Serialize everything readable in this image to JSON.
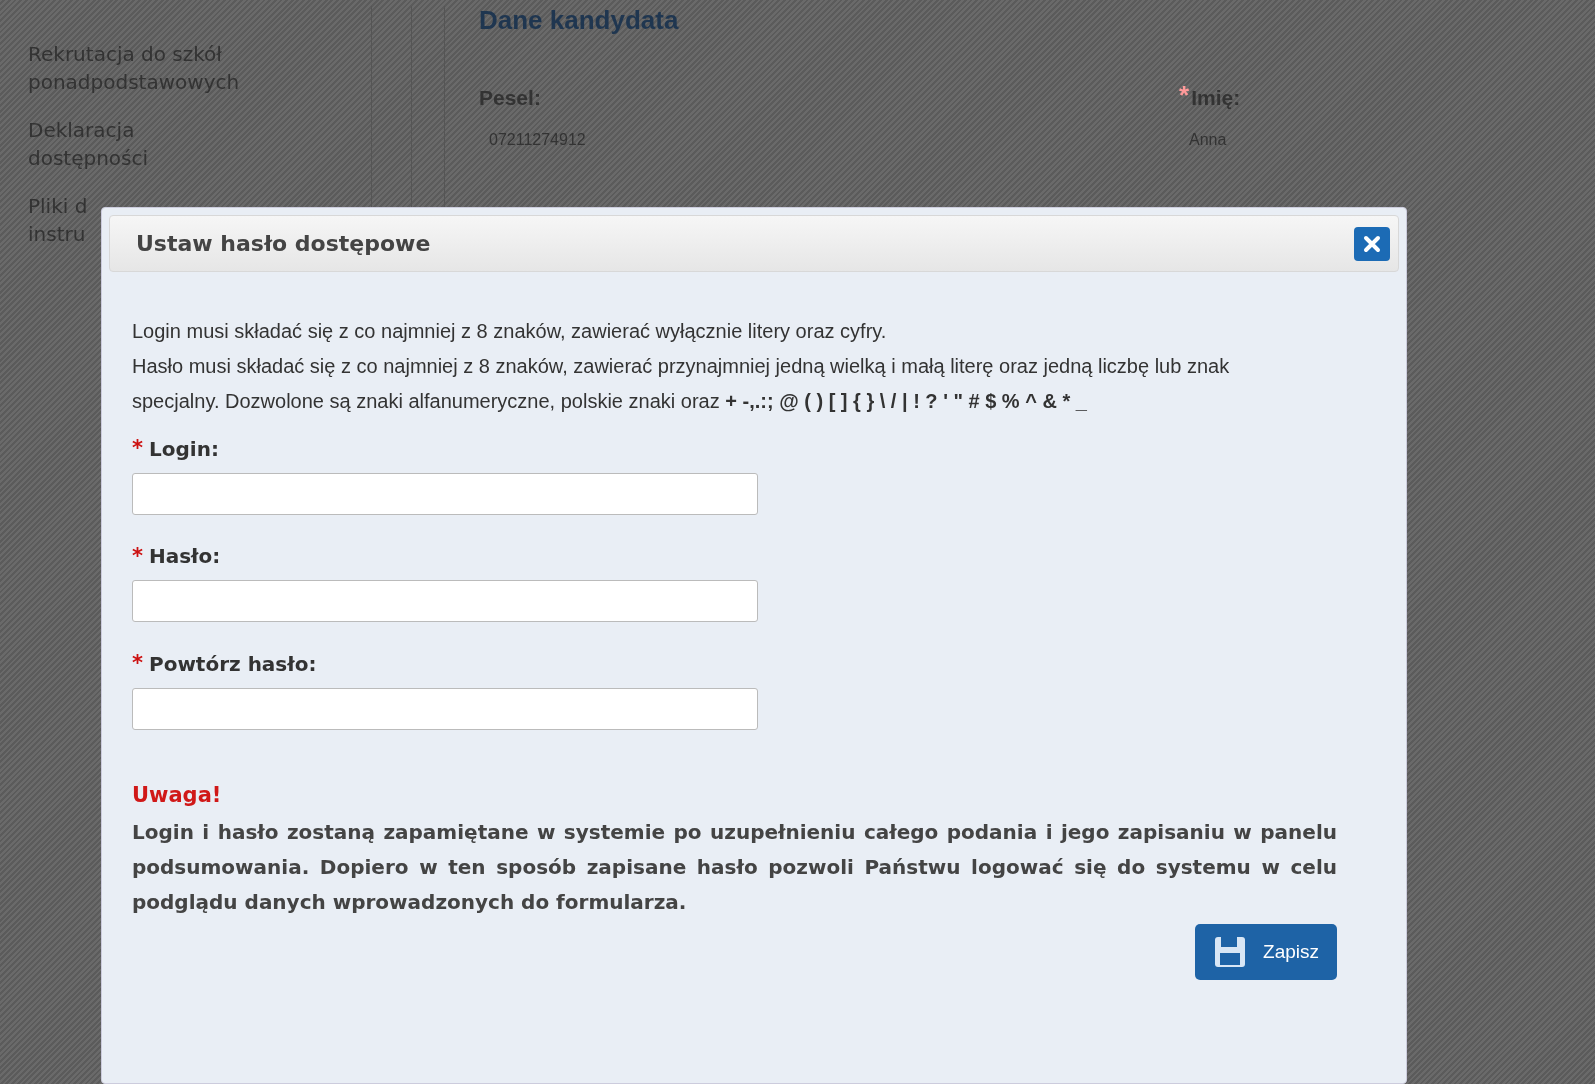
{
  "sidebar": {
    "items": [
      {
        "lines": [
          "Rekrutacja do szkół",
          "ponadpodstawowych"
        ]
      },
      {
        "lines": [
          "Deklaracja",
          "dostępności"
        ]
      },
      {
        "lines": [
          "Pliki d",
          "instru"
        ]
      }
    ]
  },
  "main": {
    "heading": "Dane kandydata",
    "fields": [
      {
        "label": "Pesel:",
        "value": "07211274912"
      },
      {
        "label": "Imię:",
        "required_mark": "*",
        "value": "Anna"
      }
    ]
  },
  "dialog": {
    "title": "Ustaw hasło dostępowe",
    "rules": [
      "Login musi składać się z co najmniej z 8 znaków, zawierać wyłącznie litery oraz cyfry.",
      "Hasło musi składać się z co najmniej z 8 znaków, zawierać przynajmniej jedną wielką i małą literę oraz jedną liczbę lub znak specjalny. Dozwolone są znaki alfanumeryczne, polskie znaki oraz **+ -,.:; @ ( ) [ ] { } \\ / | ! ? ' \" # $ % ^ & * _**"
    ],
    "fields": [
      {
        "label": "Login:",
        "required_mark": "*"
      },
      {
        "label": "Hasło:",
        "required_mark": "*"
      },
      {
        "label": "Powtórz hasło:",
        "required_mark": "*"
      }
    ],
    "warning_title": "Uwaga!",
    "warning_text": "Login i hasło zostaną zapamiętane w systemie po uzupełnieniu całego podania i jego zapisaniu w panelu podsumowania. Dopiero w ten sposób zapisane hasło pozwoli Państwu logować się do systemu w celu podglądu danych wprowadzonych do formularza.",
    "save_button": "Zapisz"
  }
}
